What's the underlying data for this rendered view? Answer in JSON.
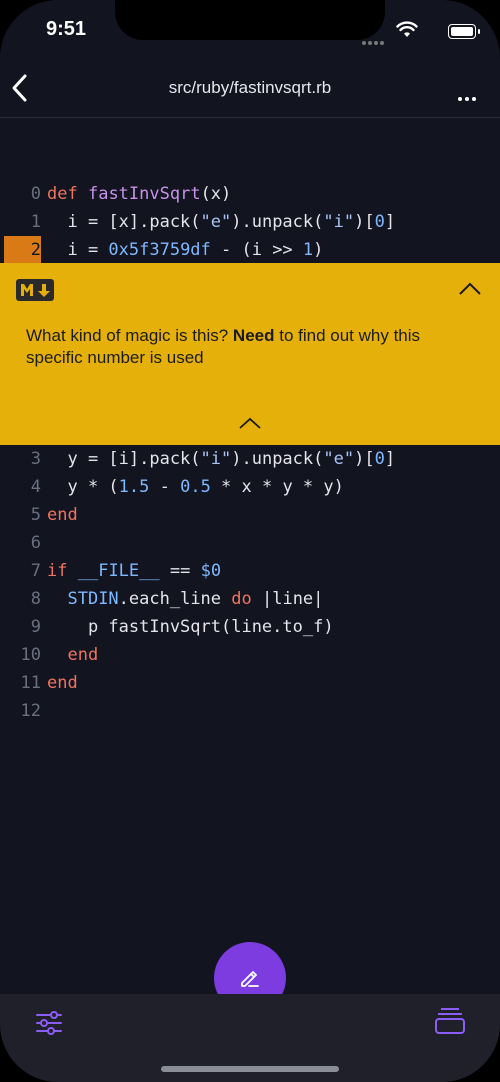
{
  "status_bar": {
    "time": "9:51"
  },
  "nav": {
    "title": "src/ruby/fastinvsqrt.rb",
    "back_icon": "chevron-left-icon",
    "more_icon": "ellipsis-icon"
  },
  "code_lines": [
    {
      "num": "0",
      "tokens": [
        [
          "kw",
          "def"
        ],
        [
          "t",
          " "
        ],
        [
          "fn",
          "fastInvSqrt"
        ],
        [
          "t",
          "(x)"
        ]
      ]
    },
    {
      "num": "1",
      "tokens": [
        [
          "t",
          "  i = [x].pack("
        ],
        [
          "str",
          "\"e\""
        ],
        [
          "t",
          ").unpack("
        ],
        [
          "str",
          "\"i\""
        ],
        [
          "t",
          ")["
        ],
        [
          "num",
          "0"
        ],
        [
          "t",
          "]"
        ]
      ]
    },
    {
      "num": "2",
      "highlight": true,
      "tokens": [
        [
          "t",
          "  i = "
        ],
        [
          "num",
          "0x5f3759df"
        ],
        [
          "t",
          " - (i >> "
        ],
        [
          "num",
          "1"
        ],
        [
          "t",
          ")"
        ]
      ]
    },
    {
      "num": "3",
      "tokens": [
        [
          "t",
          "  y = [i].pack("
        ],
        [
          "str",
          "\"i\""
        ],
        [
          "t",
          ").unpack("
        ],
        [
          "str",
          "\"e\""
        ],
        [
          "t",
          ")["
        ],
        [
          "num",
          "0"
        ],
        [
          "t",
          "]"
        ]
      ]
    },
    {
      "num": "4",
      "tokens": [
        [
          "t",
          "  y * ("
        ],
        [
          "num",
          "1.5"
        ],
        [
          "t",
          " - "
        ],
        [
          "num",
          "0.5"
        ],
        [
          "t",
          " * x * y * y)"
        ]
      ]
    },
    {
      "num": "5",
      "tokens": [
        [
          "kw",
          "end"
        ]
      ]
    },
    {
      "num": "6",
      "tokens": []
    },
    {
      "num": "7",
      "tokens": [
        [
          "kw",
          "if"
        ],
        [
          "t",
          " "
        ],
        [
          "const",
          "__FILE__"
        ],
        [
          "t",
          " == "
        ],
        [
          "const",
          "$0"
        ]
      ]
    },
    {
      "num": "8",
      "tokens": [
        [
          "t",
          "  "
        ],
        [
          "const",
          "STDIN"
        ],
        [
          "t",
          ".each_line "
        ],
        [
          "kw",
          "do"
        ],
        [
          "t",
          " |line|"
        ]
      ]
    },
    {
      "num": "9",
      "tokens": [
        [
          "t",
          "    p fastInvSqrt(line.to_f)"
        ]
      ]
    },
    {
      "num": "10",
      "tokens": [
        [
          "t",
          "  "
        ],
        [
          "kw",
          "end"
        ]
      ]
    },
    {
      "num": "11",
      "tokens": [
        [
          "kw",
          "end"
        ]
      ]
    },
    {
      "num": "12",
      "tokens": []
    }
  ],
  "annotation": {
    "badge": "M↓",
    "text_before": "What kind of magic is this? ",
    "text_bold": "Need",
    "text_after": " to find out why this specific number is used",
    "color": "#e6b00a"
  },
  "fab": {
    "icon": "edit-pencil-icon",
    "color": "#7c3ce0"
  },
  "tab_bar": {
    "left_icon": "filters-icon",
    "right_icon": "stack-icon"
  },
  "colors": {
    "background": "#121420",
    "accent": "#7c3ce0",
    "highlight": "#d97a16"
  }
}
